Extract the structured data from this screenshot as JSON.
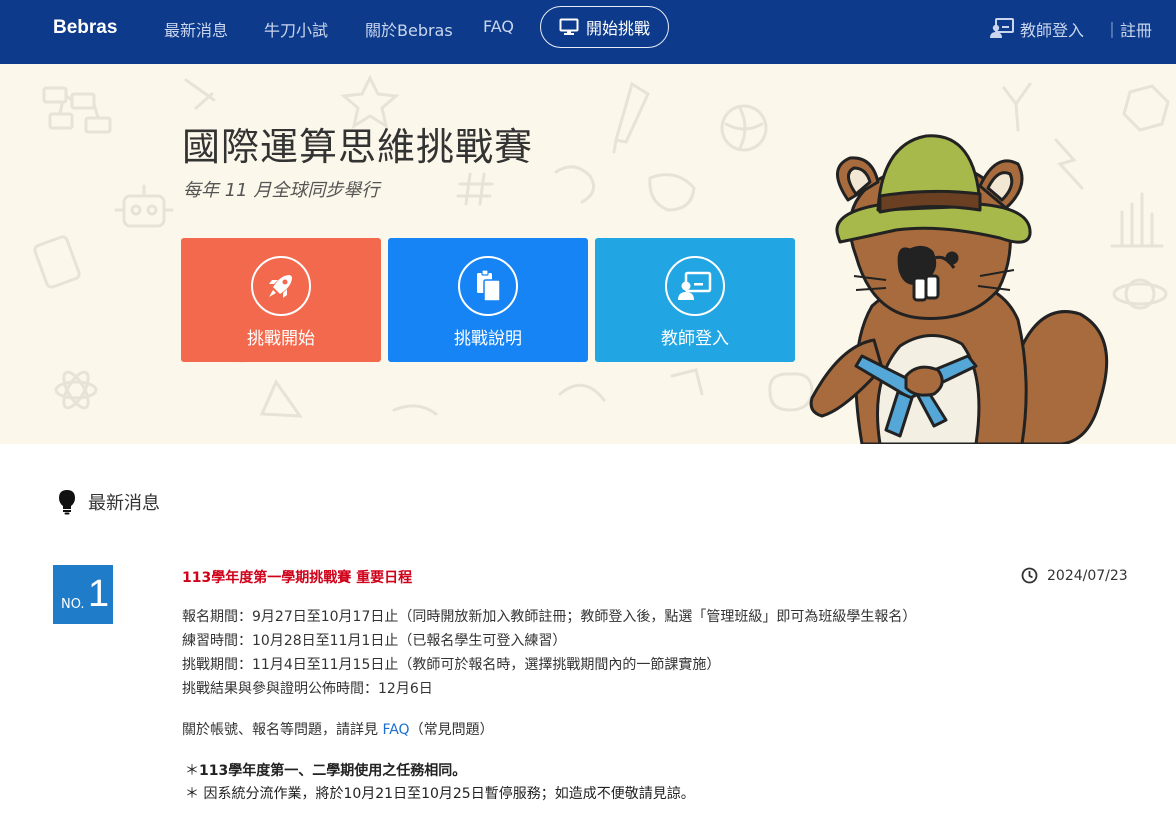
{
  "nav": {
    "brand": "Bebras",
    "links": [
      "最新消息",
      "牛刀小試",
      "關於Bebras",
      "FAQ"
    ],
    "challenge_button": "開始挑戰",
    "teacher_login": "教師登入",
    "register": "｜註冊"
  },
  "hero": {
    "title": "國際運算思維挑戰賽",
    "subtitle": "每年 11 月全球同步舉行",
    "buttons": [
      {
        "label": "挑戰開始",
        "color": "#f3694d",
        "icon": "rocket-icon"
      },
      {
        "label": "挑戰說明",
        "color": "#1684f5",
        "icon": "clipboard-icon"
      },
      {
        "label": "教師登入",
        "color": "#21a5e3",
        "icon": "teacher-icon"
      }
    ]
  },
  "news": {
    "heading": "最新消息",
    "item": {
      "no_label": "NO.",
      "no_value": "1",
      "title": "113學年度第一學期挑戰賽 重要日程",
      "date": "2024/07/23",
      "lines": [
        "報名期間：9月27日至10月17日止（同時開放新加入教師註冊；教師登入後，點選「管理班級」即可為班級學生報名）",
        "練習時間：10月28日至11月1日止（已報名學生可登入練習）",
        "挑戰期間：11月4日至11月15日止（教師可於報名時，選擇挑戰期間內的一節課實施）",
        "挑戰結果與參與證明公佈時間：12月6日"
      ],
      "faq_prefix": "關於帳號、報名等問題，請詳見 ",
      "faq_link": "FAQ",
      "faq_suffix": "（常見問題）",
      "note1_star": "＊",
      "note1_bold": "113學年度第一、二學期使用之任務相同。",
      "note2": "＊ 因系統分流作業，將於10月21日至10月25日暫停服務；如造成不便敬請見諒。"
    }
  },
  "colors": {
    "navbar": "#0d3a8a",
    "hero_bg": "#fbf7ea",
    "news_title": "#d0021b",
    "badge": "#1f7cc8",
    "link": "#1a6fd1"
  }
}
